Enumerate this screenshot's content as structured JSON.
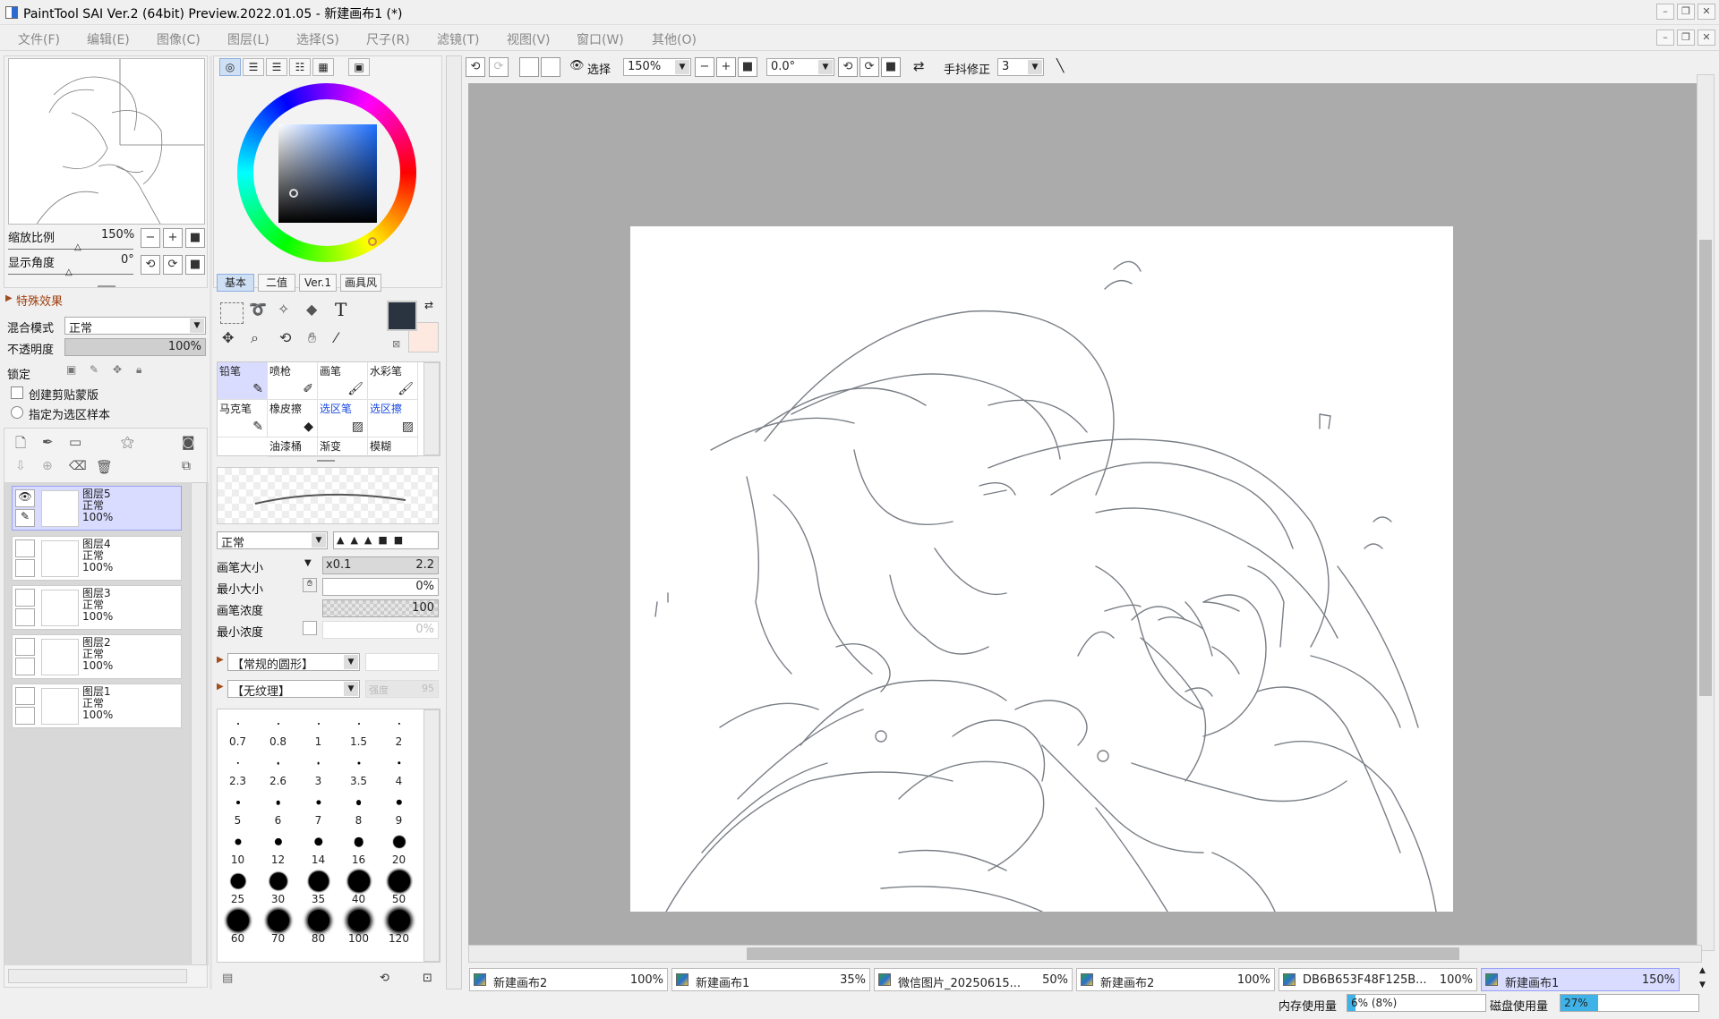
{
  "window": {
    "title": "PaintTool SAI Ver.2 (64bit) Preview.2022.01.05 - 新建画布1 (*)"
  },
  "menu": [
    "文件(F)",
    "编辑(E)",
    "图像(C)",
    "图层(L)",
    "选择(S)",
    "尺子(R)",
    "滤镜(T)",
    "视图(V)",
    "窗口(W)",
    "其他(O)"
  ],
  "navigator": {
    "zoom_label": "缩放比例",
    "zoom_value": "150%",
    "angle_label": "显示角度",
    "angle_value": "0°"
  },
  "effects": {
    "header": "特殊效果",
    "blend_label": "混合模式",
    "blend_value": "正常",
    "opacity_label": "不透明度",
    "opacity_value": "100%",
    "lock_label": "锁定",
    "clip_label": "创建剪贴蒙版",
    "select_src_label": "指定为选区样本"
  },
  "layers": [
    {
      "name": "图层5",
      "mode": "正常",
      "opacity": "100%"
    },
    {
      "name": "图层4",
      "mode": "正常",
      "opacity": "100%"
    },
    {
      "name": "图层3",
      "mode": "正常",
      "opacity": "100%"
    },
    {
      "name": "图层2",
      "mode": "正常",
      "opacity": "100%"
    },
    {
      "name": "图层1",
      "mode": "正常",
      "opacity": "100%"
    }
  ],
  "color": {
    "current": "#2a3340",
    "secondary": "#fde9e0"
  },
  "tool_tabs": [
    "基本",
    "二值",
    "Ver.1",
    "画具风"
  ],
  "tools": [
    "铅笔",
    "喷枪",
    "画笔",
    "水彩笔",
    "马克笔",
    "橡皮擦",
    "选区笔",
    "选区擦",
    "",
    "油漆桶",
    "渐变",
    "模糊"
  ],
  "brush": {
    "mode": "正常",
    "size_label": "画笔大小",
    "size_mult": "x0.1",
    "size_value": "2.2",
    "min_size_label": "最小大小",
    "min_size_value": "0%",
    "density_label": "画笔浓度",
    "density_value": "100",
    "min_density_label": "最小浓度",
    "min_density_value": "0%",
    "shape": "【常规的圆形】",
    "texture": "【无纹理】",
    "texture_strength_label": "强度",
    "texture_strength": "95"
  },
  "brush_sizes": [
    "0.7",
    "0.8",
    "1",
    "1.5",
    "2",
    "2.3",
    "2.6",
    "3",
    "3.5",
    "4",
    "5",
    "6",
    "7",
    "8",
    "9",
    "10",
    "12",
    "14",
    "16",
    "20",
    "25",
    "30",
    "35",
    "40",
    "50",
    "60",
    "70",
    "80",
    "100",
    "120"
  ],
  "toolbar": {
    "select_label": "选择",
    "zoom": "150%",
    "angle": "0.0°",
    "stabilizer_label": "手抖修正",
    "stabilizer_value": "3"
  },
  "documents": [
    {
      "name": "新建画布2",
      "zoom": "100%"
    },
    {
      "name": "新建画布1",
      "zoom": "35%"
    },
    {
      "name": "微信图片_20250615...",
      "zoom": "50%"
    },
    {
      "name": "新建画布2",
      "zoom": "100%"
    },
    {
      "name": "DB6B653F48F125B...",
      "zoom": "100%"
    },
    {
      "name": "新建画布1",
      "zoom": "150%"
    }
  ],
  "status": {
    "memory_label": "内存使用量",
    "memory_value": "6% (8%)",
    "memory_fill": 0.06,
    "disk_label": "磁盘使用量",
    "disk_value": "27%",
    "disk_fill": 0.27
  }
}
